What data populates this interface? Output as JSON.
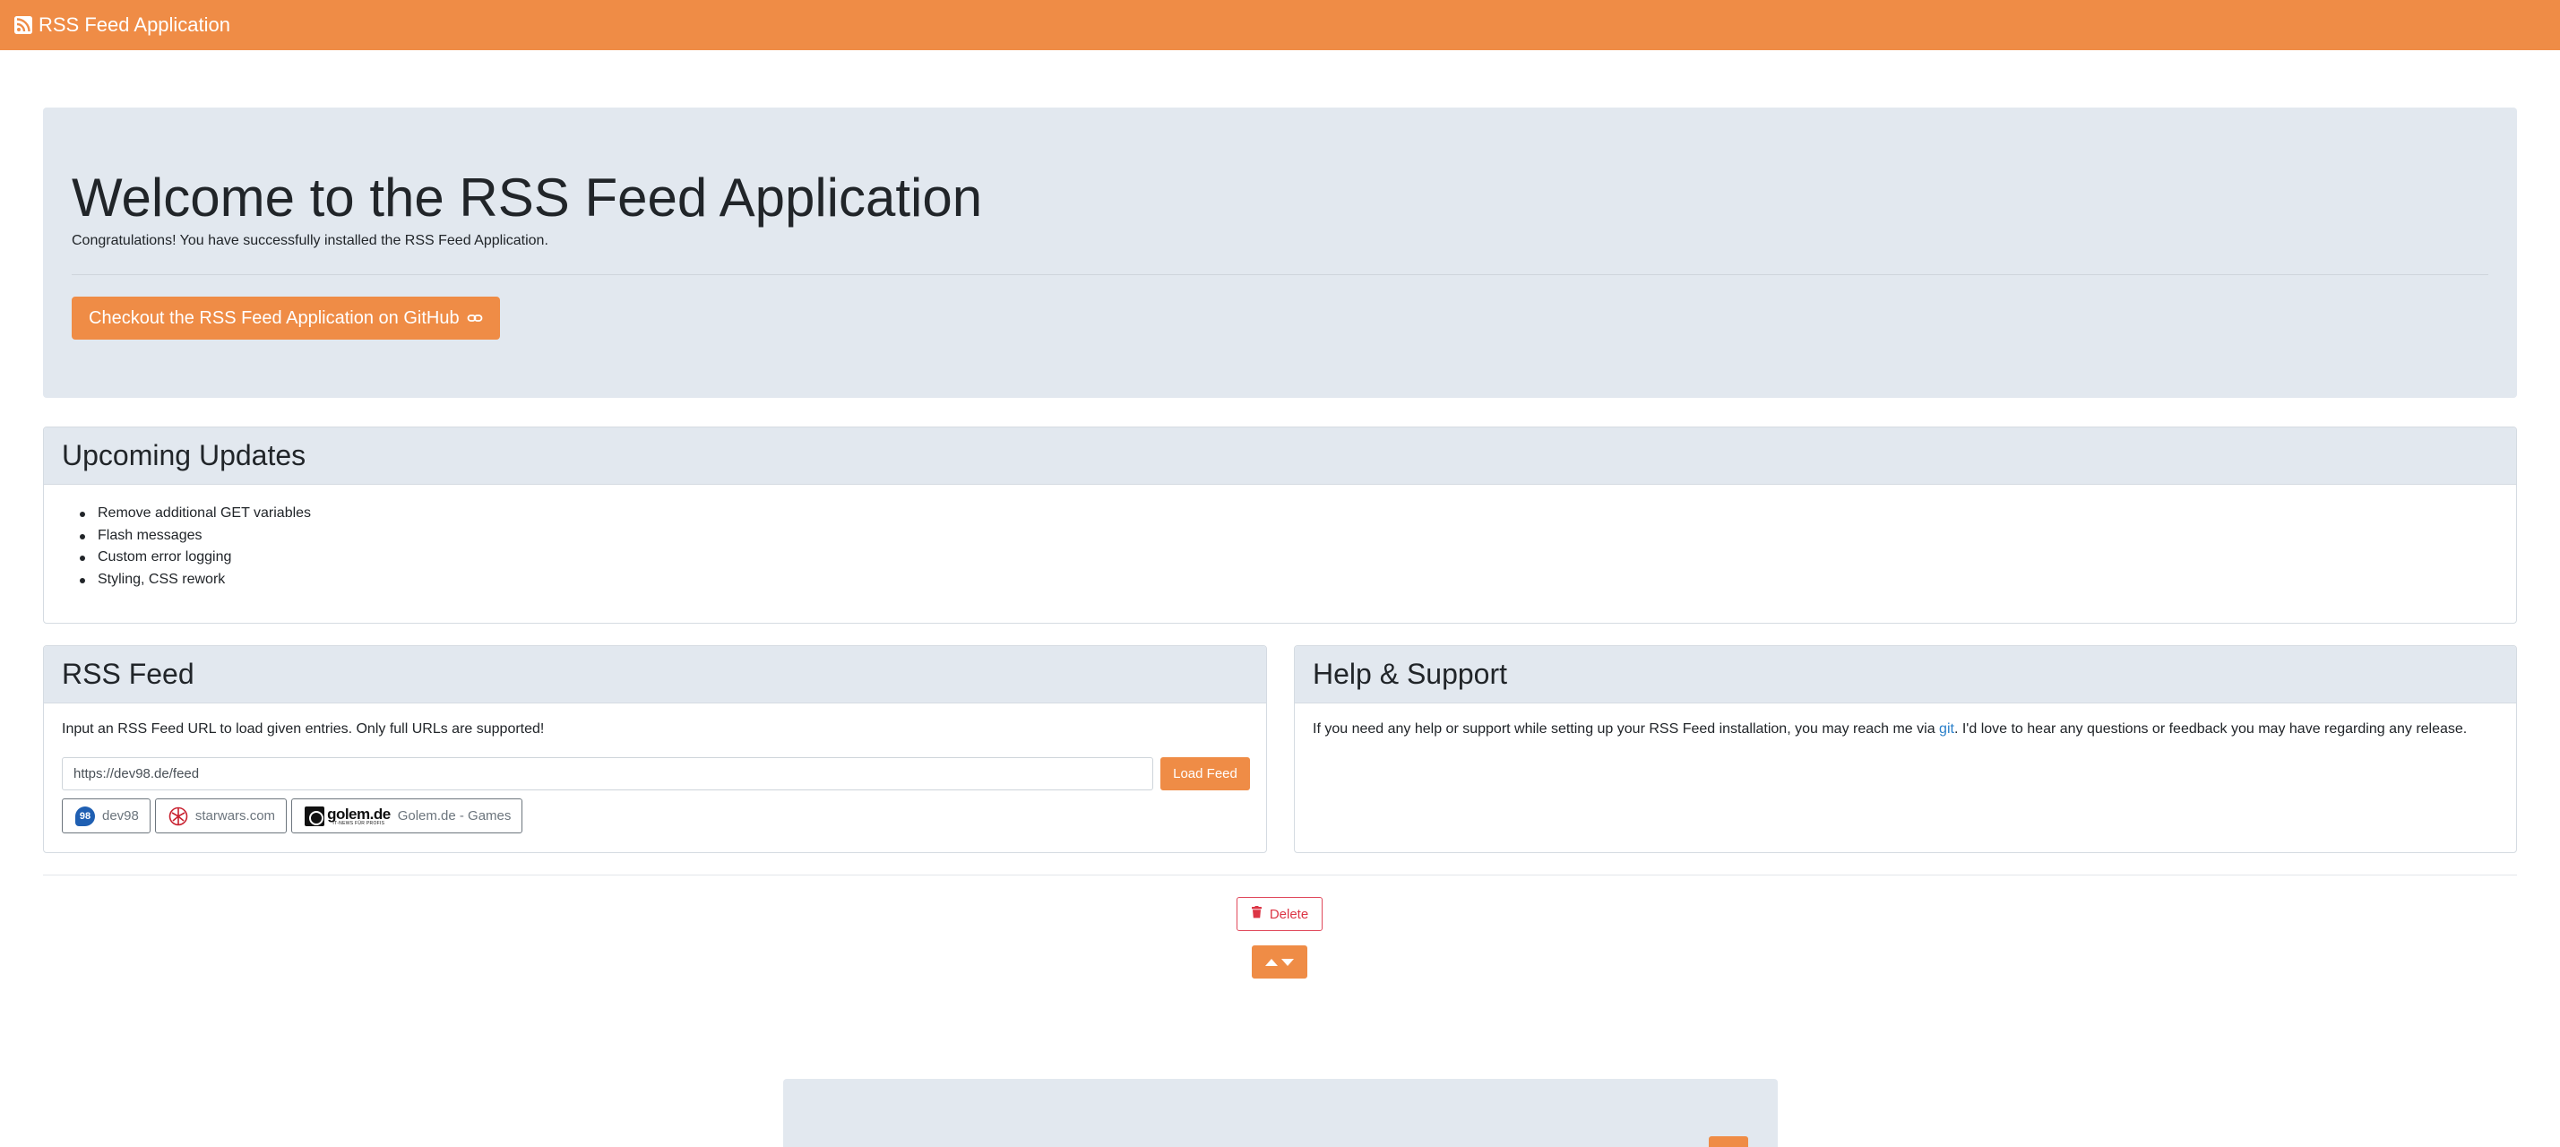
{
  "navbar": {
    "icon": "rss-icon",
    "title": "RSS Feed Application"
  },
  "jumbotron": {
    "title": "Welcome to the RSS Feed Application",
    "lead": "Congratulations! You have successfully installed the RSS Feed Application.",
    "button_label": "Checkout the RSS Feed Application on GitHub",
    "button_icon": "link-icon"
  },
  "updates": {
    "title": "Upcoming Updates",
    "items": [
      "Remove additional GET variables",
      "Flash messages",
      "Custom error logging",
      "Styling, CSS rework"
    ]
  },
  "rss": {
    "title": "RSS Feed",
    "description": "Input an RSS Feed URL to load given entries. Only full URLs are supported!",
    "input_value": "https://dev98.de/feed",
    "load_label": "Load Feed",
    "feeds": [
      {
        "label": "dev98",
        "logo_text": "98",
        "icon": "dev98-logo-icon"
      },
      {
        "label": "starwars.com",
        "icon": "starwars-logo-icon"
      },
      {
        "label": "Golem.de - Games",
        "logo_text": "golem.de",
        "logo_tagline": "IT-NEWS FÜR PROFIS",
        "icon": "golem-logo-icon"
      }
    ]
  },
  "help": {
    "title": "Help & Support",
    "text_before": "If you need any help or support while setting up your RSS Feed installation, you may reach me via ",
    "link_text": "git",
    "text_after": ". I'd love to hear any questions or feedback you may have regarding any release."
  },
  "actions": {
    "delete_label": "Delete",
    "delete_icon": "trash-icon",
    "sort_icon": "sort-arrows-icon"
  },
  "colors": {
    "accent": "#ef8c46",
    "panel": "#e2e8ef",
    "danger": "#dc3545",
    "link": "#2a7fc9"
  }
}
